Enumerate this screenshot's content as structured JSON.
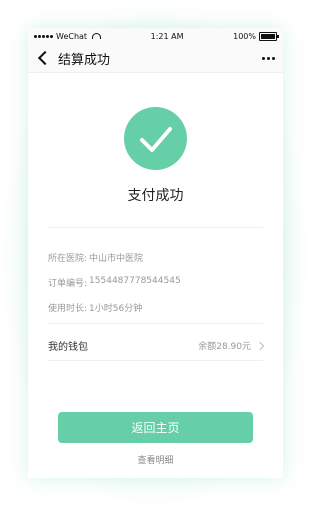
{
  "status_bar": {
    "carrier": "WeChat",
    "time": "1:21 AM",
    "battery": "100%"
  },
  "nav": {
    "title": "结算成功"
  },
  "result": {
    "title": "支付成功"
  },
  "info": [
    {
      "label": "所在医院:",
      "value": "中山市中医院"
    },
    {
      "label": "订单编号:",
      "value": "1554487778544545"
    },
    {
      "label": "使用时长:",
      "value": "1小时56分钟"
    }
  ],
  "wallet": {
    "label": "我的钱包",
    "balance": "余额28.90元"
  },
  "actions": {
    "home": "返回主页",
    "details": "查看明细"
  }
}
